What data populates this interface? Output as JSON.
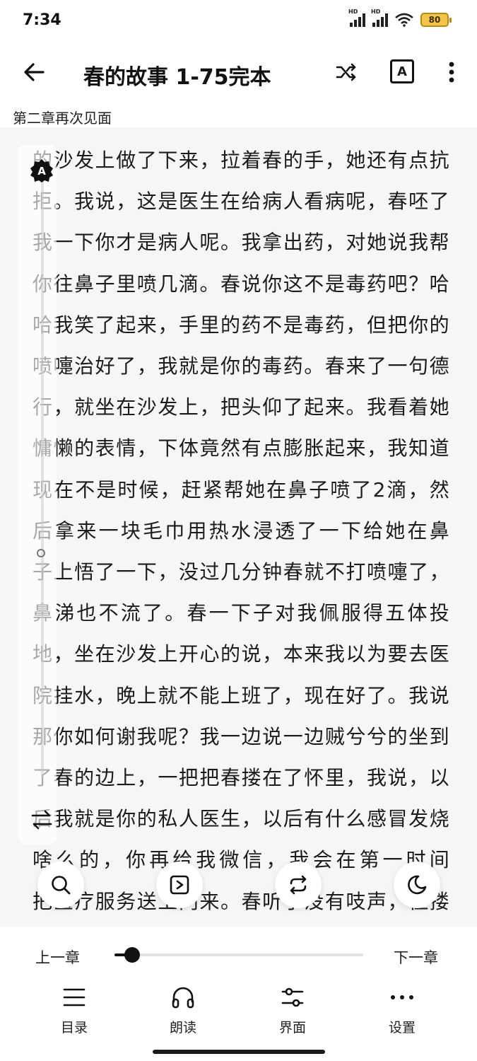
{
  "status_bar": {
    "time": "7:34",
    "signal_1_label": "HD",
    "signal_2_label": "HD",
    "battery": "80",
    "icons": [
      "signal-icon",
      "signal-icon",
      "wifi-icon",
      "battery-icon"
    ]
  },
  "app_bar": {
    "title": "春的故事 1-75完本",
    "font_button_label": "A",
    "icons": [
      "back-arrow-icon",
      "shuffle-icon",
      "font-icon",
      "more-vertical-icon"
    ]
  },
  "chapter": {
    "title": "第二章再次见面"
  },
  "reading": {
    "lines": [
      "的沙发上做了下来，拉着春的手，她还有点抗",
      "拒。我说，这是医生在给病人看病呢，春呸了",
      "我一下你才是病人呢。我拿出药，对她说我帮",
      "你往鼻子里喷几滴。春说你这不是毒药吧？哈",
      "哈我笑了起来，手里的药不是毒药，但把你的",
      "喷嚏治好了，我就是你的毒药。春来了一句德",
      "行，就坐在沙发上，把头仰了起来。我看着她",
      "慵懒的表情，下体竟然有点膨胀起来，我知道",
      "现在不是时候，赶紧帮她在鼻子喷了2滴，然",
      "后拿来一块毛巾用热水浸透了一下给她在鼻",
      "子上悟了一下，没过几分钟春就不打喷嚏了，",
      "鼻涕也不流了。春一下子对我佩服得五体投",
      "地，坐在沙发上开心的说，本来我以为要去医",
      "院挂水，晚上就不能上班了，现在好了。我说",
      "那你如何谢我呢？我一边说一边贼兮兮的坐到",
      "了春的边上，一把把春搂在了怀里，我说，以",
      "后我就是你的私人医生，以后有什么感冒发烧",
      "啥么的，你再给我微信，我会在第一时间",
      "把医疗服务送上门来。春听了没有吱声，但搂"
    ]
  },
  "side_panel": {
    "badge_label": "A",
    "icons": [
      "auto-badge-icon",
      "dot-icon",
      "swap-icon"
    ]
  },
  "floating_buttons": {
    "icons": [
      "search-icon",
      "play-icon",
      "replace-icon",
      "night-mode-icon"
    ]
  },
  "bottom_sheet": {
    "prev_chapter": "上一章",
    "next_chapter": "下一章",
    "progress_fraction": 0.07,
    "nav": [
      {
        "label": "目录",
        "icon": "menu-list-icon"
      },
      {
        "label": "朗读",
        "icon": "headphones-icon"
      },
      {
        "label": "界面",
        "icon": "sliders-icon"
      },
      {
        "label": "设置",
        "icon": "more-horizontal-icon"
      }
    ]
  }
}
